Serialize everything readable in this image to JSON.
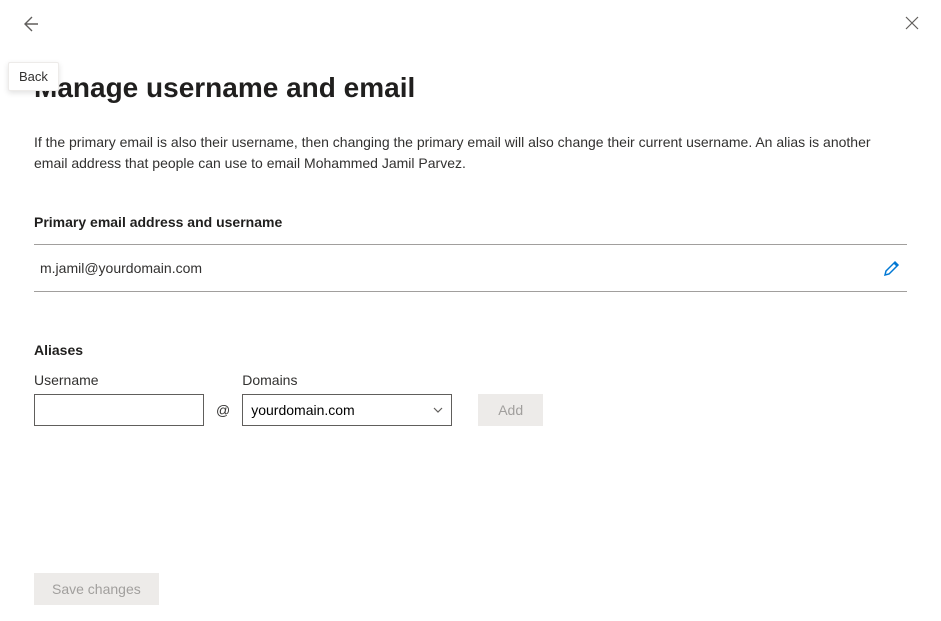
{
  "tooltip": {
    "back_label": "Back"
  },
  "page": {
    "title": "Manage username and email",
    "description": "If the primary email is also their username, then changing the primary email will also change their current username. An alias is another email address that people can use to email Mohammed Jamil Parvez."
  },
  "primary": {
    "section_label": "Primary email address and username",
    "email": "m.jamil@yourdomain.com"
  },
  "aliases": {
    "section_label": "Aliases",
    "username_label": "Username",
    "username_value": "",
    "at_symbol": "@",
    "domains_label": "Domains",
    "selected_domain": "yourdomain.com",
    "add_label": "Add"
  },
  "footer": {
    "save_label": "Save changes"
  }
}
